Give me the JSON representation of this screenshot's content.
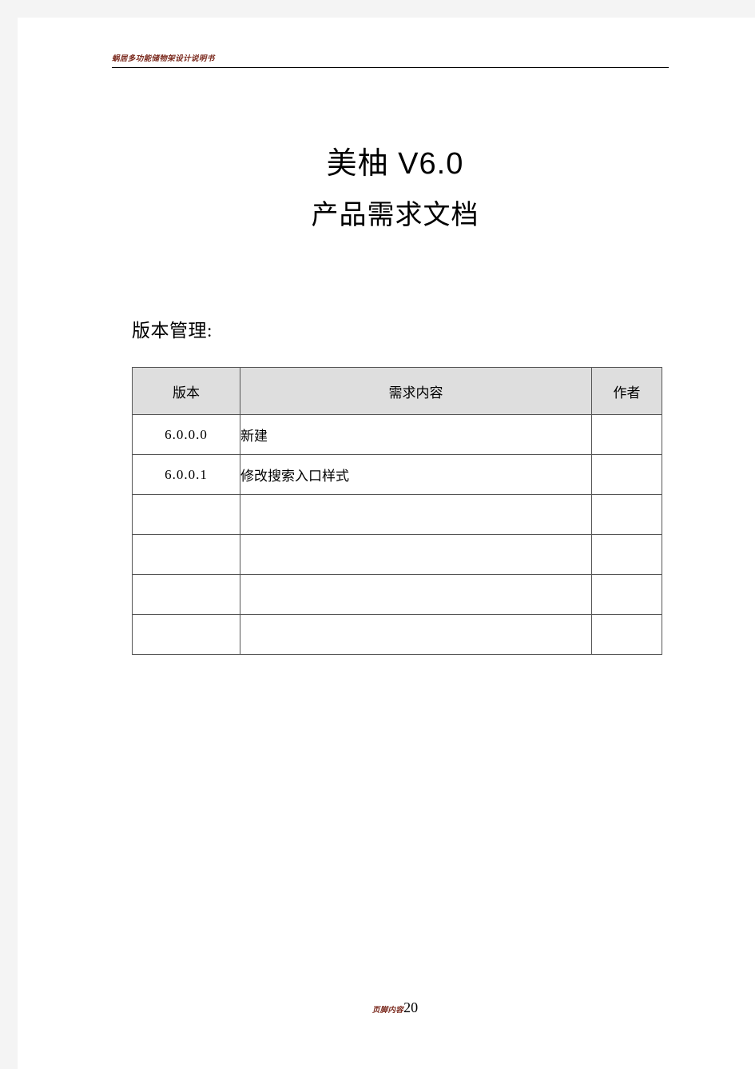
{
  "page": {
    "header_text": "蜗居多功能储物架设计说明书"
  },
  "title": {
    "line1": "美柚 V6.0",
    "line2": "产品需求文档"
  },
  "section": {
    "version_management_heading": "版本管理:"
  },
  "version_table": {
    "columns": [
      "版本",
      "需求内容",
      "作者"
    ],
    "rows": [
      {
        "version": "6.0.0.0",
        "content": "新建",
        "author": ""
      },
      {
        "version": "6.0.0.1",
        "content": "修改搜索入口样式",
        "author": ""
      },
      {
        "version": "",
        "content": "",
        "author": ""
      },
      {
        "version": "",
        "content": "",
        "author": ""
      },
      {
        "version": "",
        "content": "",
        "author": ""
      },
      {
        "version": "",
        "content": "",
        "author": ""
      }
    ]
  },
  "footer": {
    "label": "页脚内容",
    "page_number": "20"
  },
  "colors": {
    "page_background": "#ffffff",
    "canvas_background": "#f4f4f4",
    "header_text": "#7b2a1e",
    "table_header_fill": "#dedede",
    "table_border": "#555555",
    "rule": "#000000"
  }
}
